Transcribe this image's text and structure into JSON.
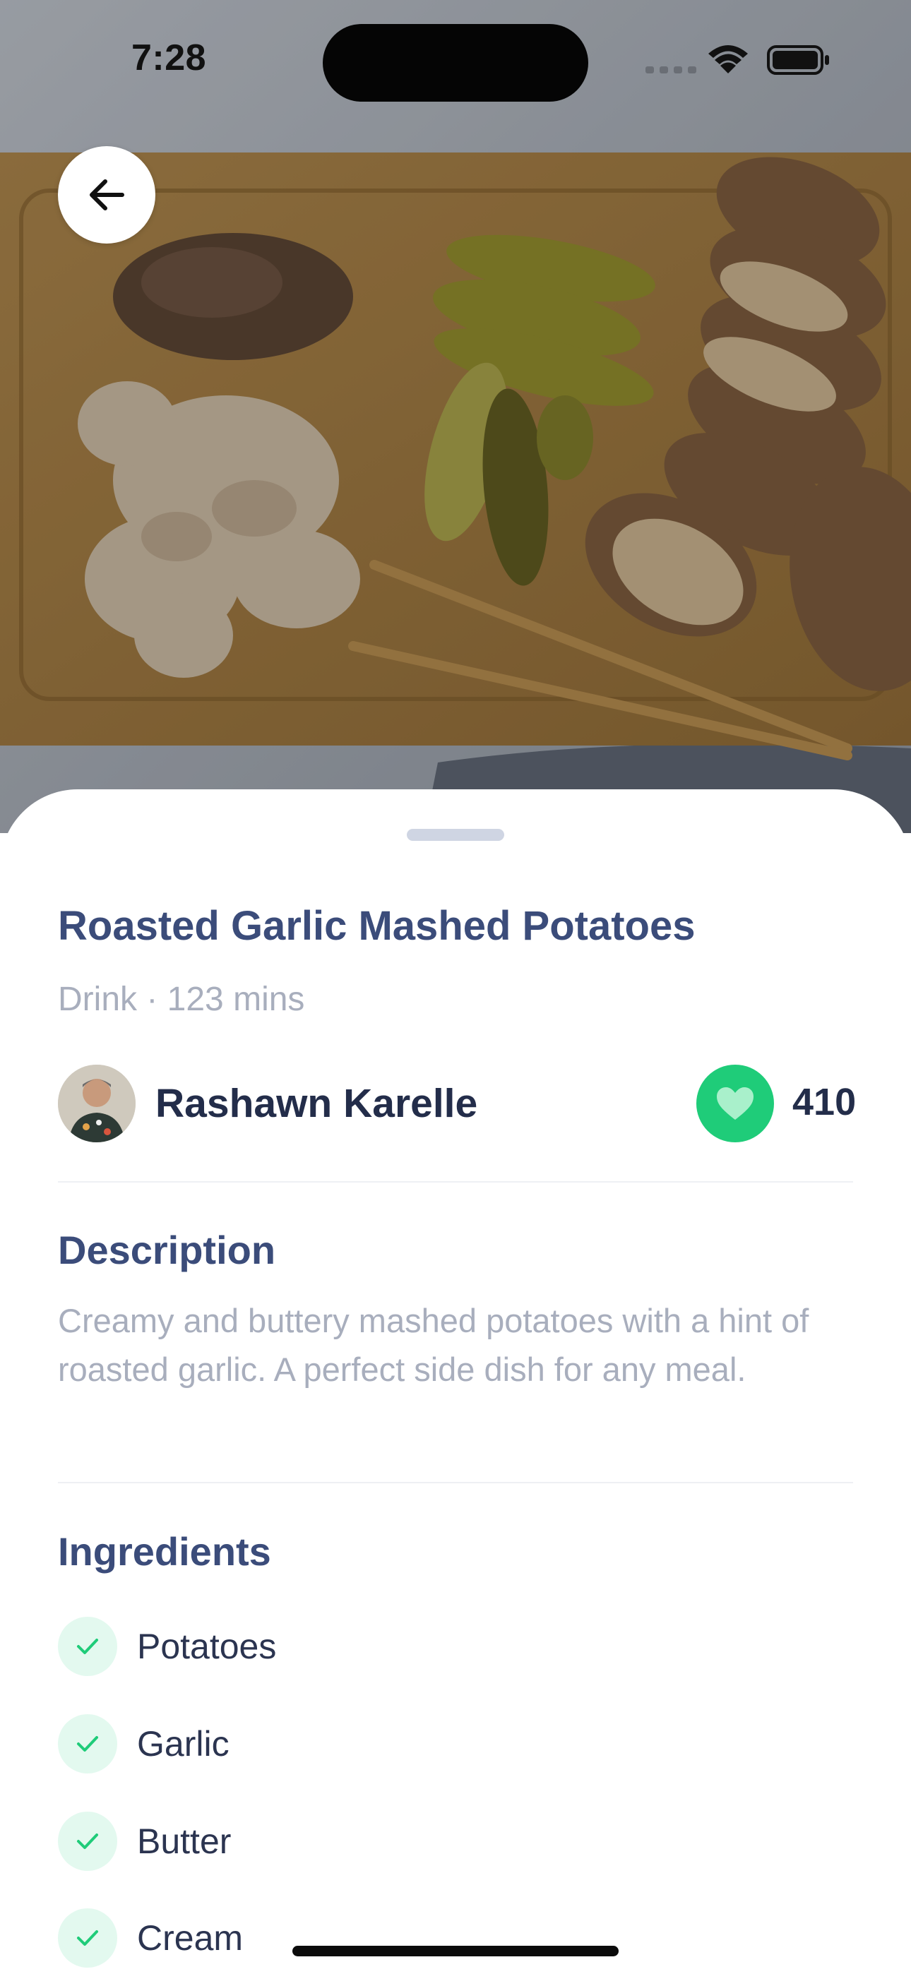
{
  "status_bar": {
    "time": "7:28",
    "icons": [
      "signal-icon",
      "wifi-icon",
      "battery-icon"
    ]
  },
  "header": {
    "back_icon": "arrow-left-icon"
  },
  "recipe": {
    "title": "Roasted Garlic Mashed Potatoes",
    "meta": "Drink · 123 mins",
    "author": {
      "name": "Rashawn Karelle",
      "avatar": "avatar"
    },
    "likes": {
      "icon": "heart-icon",
      "count": "410"
    },
    "description": {
      "heading": "Description",
      "text": "Creamy and buttery mashed potatoes with a hint of roasted garlic. A perfect side dish for any meal."
    },
    "ingredients": {
      "heading": "Ingredients",
      "items": [
        {
          "label": "Potatoes"
        },
        {
          "label": "Garlic"
        },
        {
          "label": "Butter"
        },
        {
          "label": "Cream"
        }
      ]
    }
  },
  "colors": {
    "accent_green": "#1fcc79",
    "title_blue": "#3b4c7a",
    "muted_text": "#a8aebd"
  }
}
